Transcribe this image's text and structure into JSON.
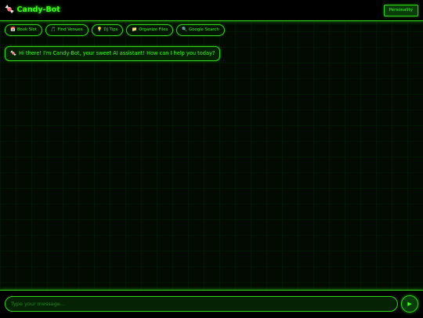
{
  "colors": {
    "accent": "#39ff14",
    "background": "#020a02",
    "panel": "#000000"
  },
  "header": {
    "logo_icon": "🍬",
    "logo_icon_name": "candy-icon",
    "title": "Candy-Bot",
    "personality_label": "Personality"
  },
  "quick_actions": [
    {
      "icon": "📅",
      "icon_name": "calendar-icon",
      "label": "Book Slot"
    },
    {
      "icon": "🎵",
      "icon_name": "music-note-icon",
      "label": "Find Venues"
    },
    {
      "icon": "💡",
      "icon_name": "lightbulb-icon",
      "label": "DJ Tips"
    },
    {
      "icon": "📁",
      "icon_name": "folder-icon",
      "label": "Organize Files"
    },
    {
      "icon": "🔍",
      "icon_name": "search-icon",
      "label": "Google Search"
    }
  ],
  "messages": [
    {
      "sender": "bot",
      "icon": "🍬",
      "icon_name": "candy-icon",
      "text": "Hi there! I'm Candy-Bot, your sweet AI assistant! How can I help you today?"
    }
  ],
  "composer": {
    "placeholder": "Type your message...",
    "value": "",
    "send_icon": "▶",
    "send_icon_name": "send-icon"
  }
}
